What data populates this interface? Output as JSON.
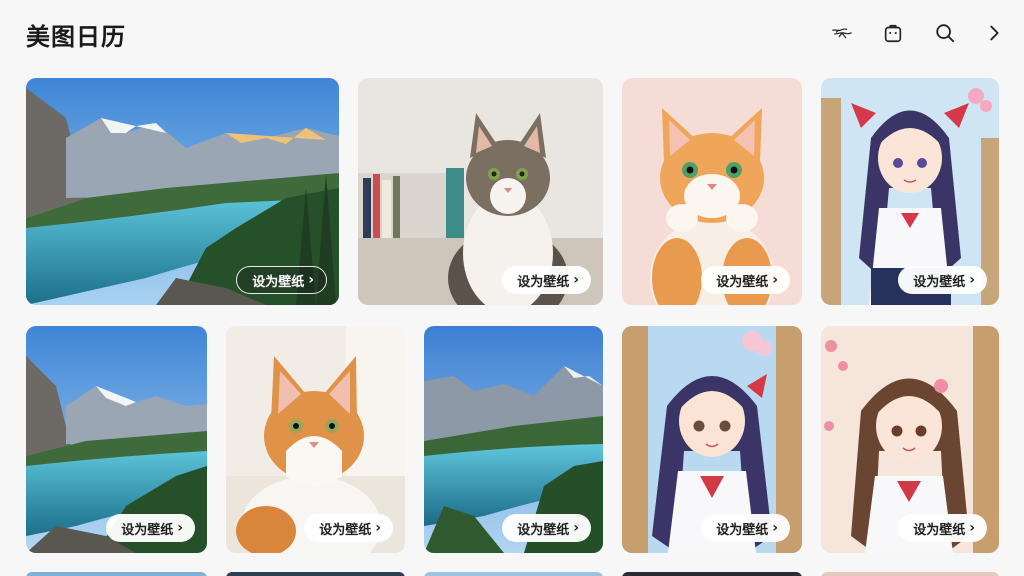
{
  "header": {
    "title": "美图日历",
    "icons": [
      "weather-sketch-icon",
      "bag-icon",
      "search-icon",
      "chevron-right-icon"
    ]
  },
  "cards": [
    {
      "subject": "mountain-lake",
      "button_label": "设为壁纸"
    },
    {
      "subject": "tabby-cat",
      "button_label": "设为壁纸"
    },
    {
      "subject": "orange-cat-cartoon",
      "button_label": "设为壁纸"
    },
    {
      "subject": "anime-girl-dark-hair",
      "button_label": "设为壁纸"
    },
    {
      "subject": "mountain-lake",
      "button_label": "设为壁纸"
    },
    {
      "subject": "orange-white-cat",
      "button_label": "设为壁纸"
    },
    {
      "subject": "mountain-lake",
      "button_label": "设为壁纸"
    },
    {
      "subject": "anime-girl-dark-hair",
      "button_label": "设为壁纸"
    },
    {
      "subject": "anime-girl-brown-hair",
      "button_label": "设为壁纸"
    }
  ],
  "colors": {
    "background": "#f7f7f8",
    "title": "#1a1a1a",
    "button_bg": "#ffffff"
  }
}
